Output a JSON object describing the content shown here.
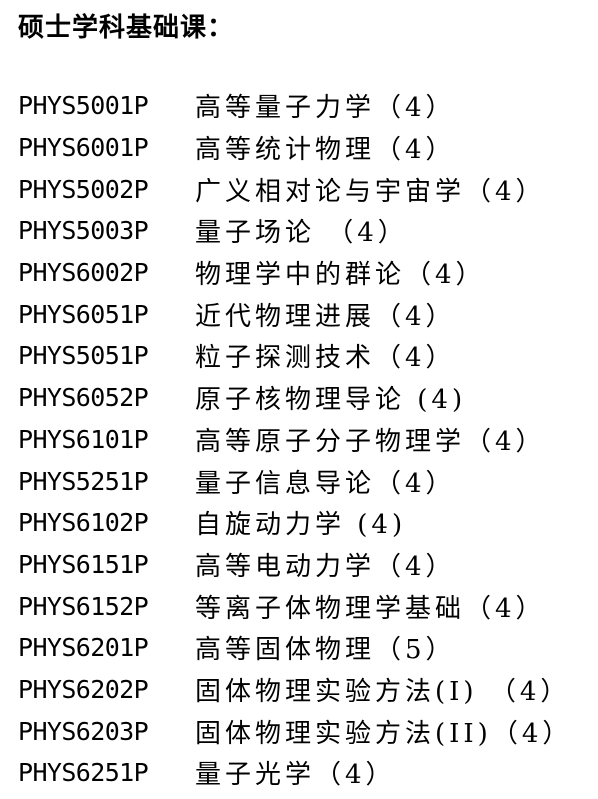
{
  "heading": "硕士学科基础课：",
  "courses": [
    {
      "code": "PHYS5001P",
      "name": "高等量子力学（4）"
    },
    {
      "code": "PHYS6001P",
      "name": "高等统计物理（4）"
    },
    {
      "code": "PHYS5002P",
      "name": "广义相对论与宇宙学（4）"
    },
    {
      "code": "PHYS5003P",
      "name": "量子场论 （4）"
    },
    {
      "code": "PHYS6002P",
      "name": "物理学中的群论（4）"
    },
    {
      "code": "PHYS6051P",
      "name": "近代物理进展（4）"
    },
    {
      "code": "PHYS5051P",
      "name": "粒子探测技术（4）"
    },
    {
      "code": "PHYS6052P",
      "name": "原子核物理导论 (4)"
    },
    {
      "code": "PHYS6101P",
      "name": "高等原子分子物理学（4）"
    },
    {
      "code": "PHYS5251P",
      "name": "量子信息导论（4）"
    },
    {
      "code": "PHYS6102P",
      "name": "自旋动力学  (4)"
    },
    {
      "code": "PHYS6151P",
      "name": "高等电动力学（4）"
    },
    {
      "code": "PHYS6152P",
      "name": "等离子体物理学基础（4）"
    },
    {
      "code": "PHYS6201P",
      "name": "高等固体物理（5）"
    },
    {
      "code": "PHYS6202P",
      "name": "固体物理实验方法(I) （4）"
    },
    {
      "code": "PHYS6203P",
      "name": "固体物理实验方法(II)（4）"
    },
    {
      "code": "PHYS6251P",
      "name": "量子光学（4）"
    }
  ]
}
